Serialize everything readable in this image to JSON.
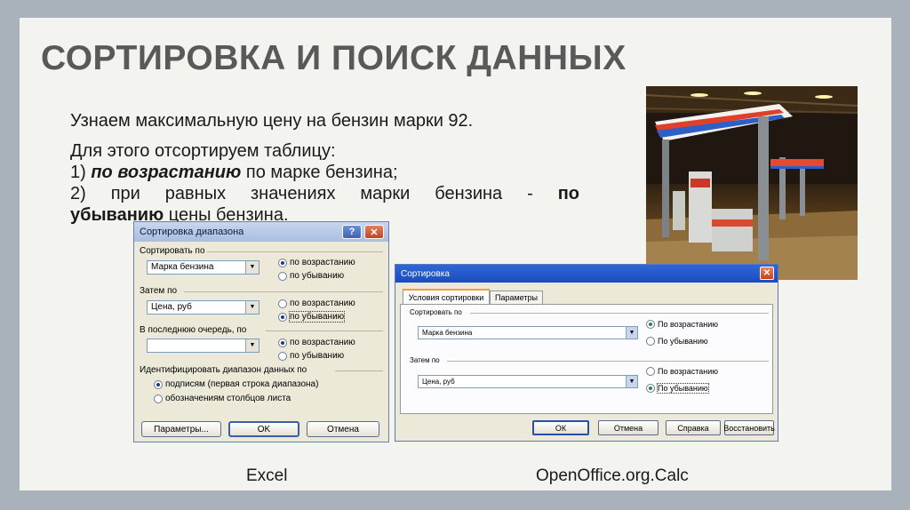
{
  "slide": {
    "title": "СОРТИРОВКА И ПОИСК ДАННЫХ",
    "line1": "Узнаем максимальную цену на бензин марки 92.",
    "line2": "Для этого отсортируем таблицу:",
    "line3_num": "1) ",
    "line3_bold": "по возрастанию",
    "line3_rest": " по марке бензина;",
    "line4_start": "2)  при  равных  значениях  марки  бензина  -",
    "line4_bold": "по",
    "line5_bold": "убыванию",
    "line5_rest": " цены бензина.",
    "caption_excel": "Excel",
    "caption_oo": "OpenOffice.org.Calc"
  },
  "excel_dialog": {
    "title": "Сортировка диапазона",
    "help_btn": "?",
    "close_btn": "✕",
    "sort_by_label": "Сортировать по",
    "sort_by_value": "Марка бензина",
    "then_by_label": "Затем по",
    "then_by_value": "Цена, руб",
    "last_by_label": "В последнюю очередь, по",
    "last_by_value": "",
    "asc": "по возрастанию",
    "desc": "по убыванию",
    "identify_label": "Идентифицировать диапазон данных по",
    "opt_headers": "подписям (первая строка диапазона)",
    "opt_columns": "обозначениям столбцов листа",
    "params_btn": "Параметры...",
    "ok_btn": "OK",
    "cancel_btn": "Отмена"
  },
  "oo_dialog": {
    "title": "Сортировка",
    "close_btn": "✕",
    "tab_conditions": "Условия сортировки",
    "tab_params": "Параметры",
    "sort_by_label": "Сортировать по",
    "sort_by_value": "Марка бензина",
    "then_by_label": "Затем по",
    "then_by_value": "Цена, руб",
    "asc": "По возрастанию",
    "desc": "По убыванию",
    "ok_btn": "ОК",
    "cancel_btn": "Отмена",
    "help_btn": "Справка",
    "restore_btn": "Восстановить"
  }
}
